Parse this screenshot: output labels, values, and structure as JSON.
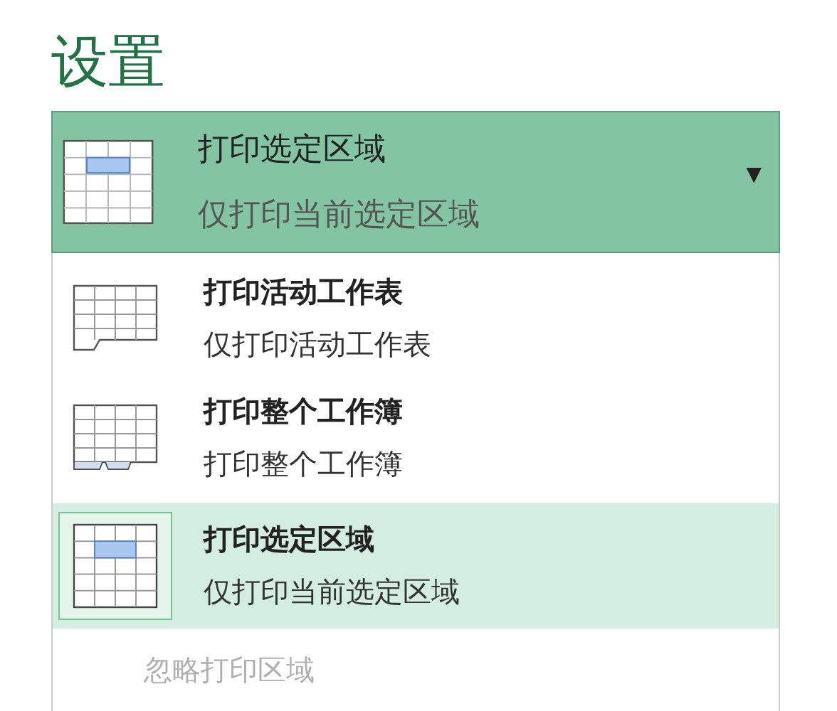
{
  "heading": "设置",
  "dropdown": {
    "title": "打印选定区域",
    "subtitle": "仅打印当前选定区域",
    "kind": "selection",
    "caret": "▼"
  },
  "options": [
    {
      "title": "打印活动工作表",
      "subtitle": "仅打印活动工作表",
      "kind": "sheet",
      "selected": false
    },
    {
      "title": "打印整个工作簿",
      "subtitle": "打印整个工作簿",
      "kind": "workbook",
      "selected": false
    },
    {
      "title": "打印选定区域",
      "subtitle": "仅打印当前选定区域",
      "kind": "selection",
      "selected": true
    }
  ],
  "footer_option": {
    "label": "忽略打印区域",
    "disabled": true
  }
}
